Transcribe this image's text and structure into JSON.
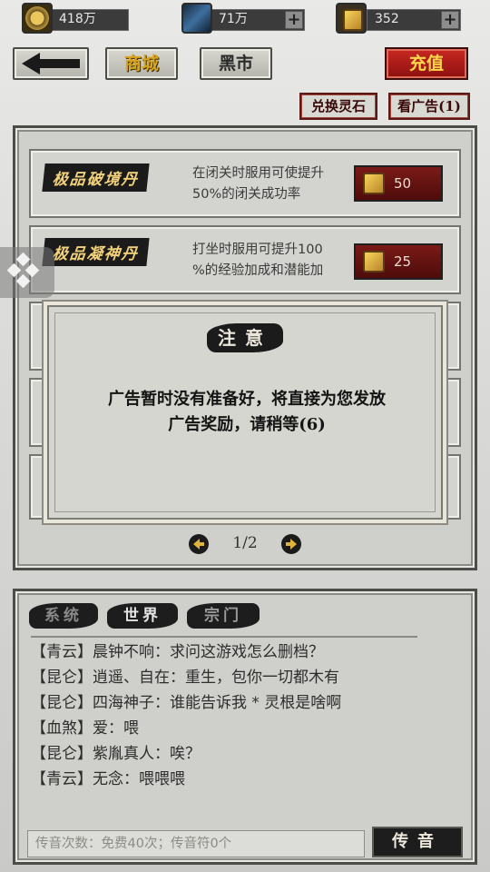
{
  "currency": {
    "spirit_stone": "418万",
    "crystal": "71万",
    "gold_ticket": "352"
  },
  "nav": {
    "back": "",
    "shop": "商城",
    "black_market": "黑市",
    "recharge": "充值"
  },
  "actions": {
    "exchange_stone": "兑换灵石",
    "watch_ad": "看广告(1)"
  },
  "items": [
    {
      "name": "极品破境丹",
      "desc1": "在闭关时服用可使提升",
      "desc2": "50%的闭关成功率",
      "price": "50"
    },
    {
      "name": "极品凝神丹",
      "desc1": "打坐时服用可提升100",
      "desc2": "%的经验加成和潜能加",
      "price": "25"
    }
  ],
  "dialog": {
    "title": "注意",
    "line1": "广告暂时没有准备好，将直接为您发放",
    "line2": "广告奖励，请稍等(6)"
  },
  "pager": {
    "text": "1/2"
  },
  "chat": {
    "tabs": [
      "系统",
      "世界",
      "宗门"
    ],
    "messages": [
      {
        "channel": "【青云】",
        "text": "晨钟不响：求问这游戏怎么删档？"
      },
      {
        "channel": "【昆仑】",
        "text": "逍遥、自在：重生，包你一切都木有"
      },
      {
        "channel": "【昆仑】",
        "text": "四海神子：谁能告诉我 * 灵根是啥啊"
      },
      {
        "channel": "【血煞】",
        "text": "爱：喂"
      },
      {
        "channel": "【昆仑】",
        "text": "紫胤真人：唉？"
      },
      {
        "channel": "【青云】",
        "text": "无念：喂喂喂"
      }
    ],
    "input_placeholder": "传音次数：免费40次；传音符0个",
    "send": "传音"
  },
  "colors": {
    "accent_red": "#a3171a",
    "gold": "#f4d27a",
    "ink": "#1b1b1b"
  }
}
